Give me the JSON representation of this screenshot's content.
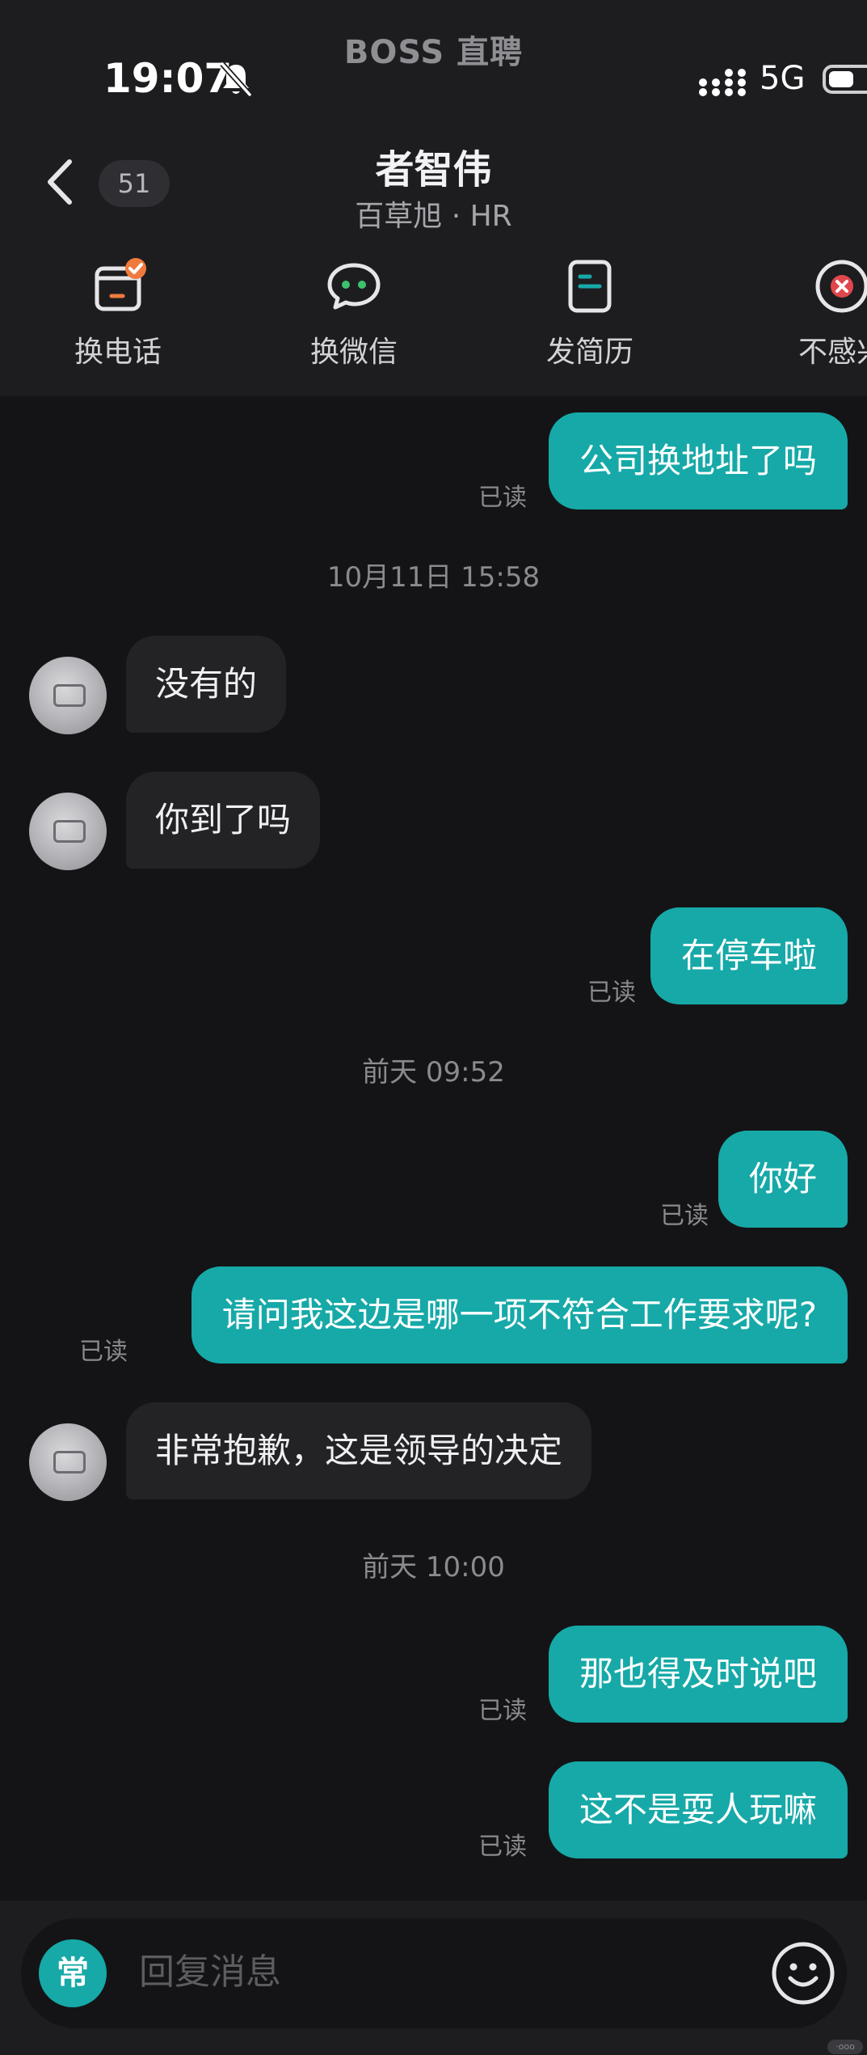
{
  "status_bar": {
    "app_name": "BOSS 直聘",
    "time": "19:07",
    "network": "5G",
    "icons": [
      "bell-off-icon",
      "signal-icon",
      "battery-icon"
    ]
  },
  "header": {
    "unread_count": "51",
    "contact_name": "者智伟",
    "contact_subtitle": "百草旭 · HR"
  },
  "actions": [
    {
      "label": "换电话",
      "icon": "phone-card-icon"
    },
    {
      "label": "换微信",
      "icon": "wechat-icon"
    },
    {
      "label": "发简历",
      "icon": "resume-icon"
    },
    {
      "label": "不感兴",
      "icon": "close-circle-icon"
    }
  ],
  "chat": {
    "messages": [
      {
        "type": "out",
        "text": "公司换地址了吗",
        "status": "已读"
      },
      {
        "type": "time",
        "text": "10月11日 15:58"
      },
      {
        "type": "in",
        "text": "没有的"
      },
      {
        "type": "in",
        "text": "你到了吗"
      },
      {
        "type": "out",
        "text": "在停车啦",
        "status": "已读"
      },
      {
        "type": "time",
        "text": "前天 09:52"
      },
      {
        "type": "out",
        "text": "你好",
        "status": "已读"
      },
      {
        "type": "out",
        "text": "请问我这边是哪一项不符合工作要求呢?",
        "status": "已读"
      },
      {
        "type": "in",
        "text": "非常抱歉，这是领导的决定"
      },
      {
        "type": "time",
        "text": "前天 10:00"
      },
      {
        "type": "out",
        "text": "那也得及时说吧",
        "status": "已读"
      },
      {
        "type": "out",
        "text": "这不是耍人玩嘛",
        "status": "已读"
      }
    ]
  },
  "input_bar": {
    "common_label": "常",
    "placeholder": "回复消息"
  },
  "colors": {
    "accent": "#16a9a8",
    "background": "#141416",
    "panel": "#1d1d20",
    "incoming_bubble": "#232326",
    "badge_orange": "#f07a3c",
    "close_red": "#e0474c",
    "wechat_green": "#3cc26c"
  }
}
